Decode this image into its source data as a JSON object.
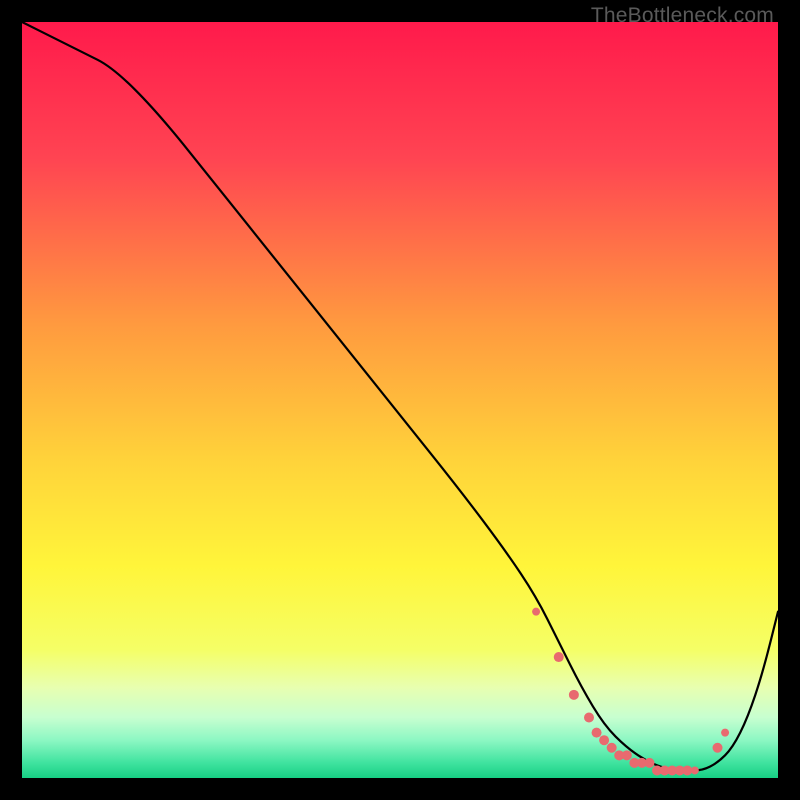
{
  "watermark": "TheBottleneck.com",
  "chart_data": {
    "type": "line",
    "title": "",
    "xlabel": "",
    "ylabel": "",
    "xlim": [
      0,
      100
    ],
    "ylim": [
      0,
      100
    ],
    "gradient_stops": [
      {
        "offset": 0,
        "color": "#ff1a4b"
      },
      {
        "offset": 18,
        "color": "#ff4452"
      },
      {
        "offset": 40,
        "color": "#ff9a3f"
      },
      {
        "offset": 58,
        "color": "#ffd33a"
      },
      {
        "offset": 72,
        "color": "#fff53a"
      },
      {
        "offset": 83,
        "color": "#f5ff66"
      },
      {
        "offset": 88,
        "color": "#e8ffb0"
      },
      {
        "offset": 92,
        "color": "#c7ffd0"
      },
      {
        "offset": 95,
        "color": "#8cf7c3"
      },
      {
        "offset": 98,
        "color": "#3fe39f"
      },
      {
        "offset": 100,
        "color": "#17cf84"
      }
    ],
    "series": [
      {
        "name": "bottleneck-curve",
        "x": [
          0,
          4,
          8,
          12,
          18,
          26,
          34,
          42,
          50,
          58,
          64,
          68,
          71,
          74,
          77,
          80,
          83,
          86,
          88,
          90,
          92,
          94,
          96,
          98,
          100
        ],
        "y": [
          100,
          98,
          96,
          94,
          88,
          78,
          68,
          58,
          48,
          38,
          30,
          24,
          18,
          12,
          7,
          4,
          2,
          1,
          1,
          1,
          2,
          4,
          8,
          14,
          22
        ]
      }
    ],
    "markers": {
      "name": "highlight-points",
      "color": "#e86a6f",
      "x": [
        68,
        71,
        73,
        75,
        76,
        77,
        78,
        79,
        80,
        81,
        82,
        83,
        84,
        85,
        86,
        87,
        88,
        89,
        92,
        93
      ],
      "y": [
        22,
        16,
        11,
        8,
        6,
        5,
        4,
        3,
        3,
        2,
        2,
        2,
        1,
        1,
        1,
        1,
        1,
        1,
        4,
        6
      ],
      "r": [
        4,
        5,
        5,
        5,
        5,
        5,
        5,
        5,
        5,
        5,
        5,
        5,
        5,
        5,
        5,
        5,
        5,
        4,
        5,
        4
      ]
    }
  }
}
